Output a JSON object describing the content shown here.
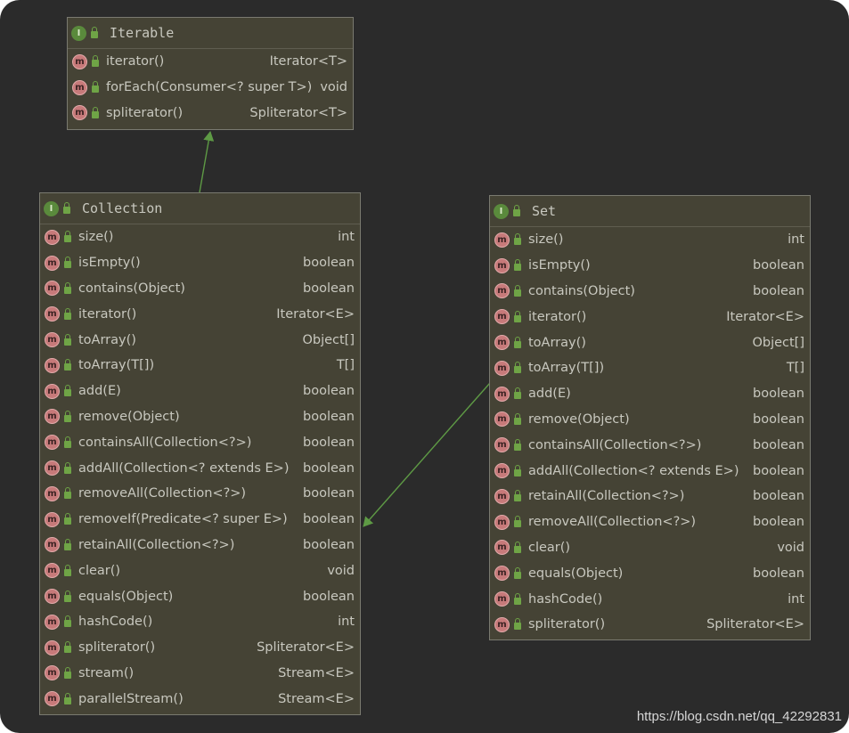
{
  "diagram": {
    "classes": [
      {
        "id": "iterable",
        "name": "Iterable",
        "kind_icon": "I",
        "methods": [
          {
            "name": "iterator()",
            "type": "Iterator<T>"
          },
          {
            "name": "forEach(Consumer<? super T>)",
            "type": "void"
          },
          {
            "name": "spliterator()",
            "type": "Spliterator<T>"
          }
        ]
      },
      {
        "id": "collection",
        "name": "Collection",
        "kind_icon": "I",
        "methods": [
          {
            "name": "size()",
            "type": "int"
          },
          {
            "name": "isEmpty()",
            "type": "boolean"
          },
          {
            "name": "contains(Object)",
            "type": "boolean"
          },
          {
            "name": "iterator()",
            "type": "Iterator<E>"
          },
          {
            "name": "toArray()",
            "type": "Object[]"
          },
          {
            "name": "toArray(T[])",
            "type": "T[]"
          },
          {
            "name": "add(E)",
            "type": "boolean"
          },
          {
            "name": "remove(Object)",
            "type": "boolean"
          },
          {
            "name": "containsAll(Collection<?>)",
            "type": "boolean"
          },
          {
            "name": "addAll(Collection<? extends E>)",
            "type": "boolean"
          },
          {
            "name": "removeAll(Collection<?>)",
            "type": "boolean"
          },
          {
            "name": "removeIf(Predicate<? super E>)",
            "type": "boolean"
          },
          {
            "name": "retainAll(Collection<?>)",
            "type": "boolean"
          },
          {
            "name": "clear()",
            "type": "void"
          },
          {
            "name": "equals(Object)",
            "type": "boolean"
          },
          {
            "name": "hashCode()",
            "type": "int"
          },
          {
            "name": "spliterator()",
            "type": "Spliterator<E>"
          },
          {
            "name": "stream()",
            "type": "Stream<E>"
          },
          {
            "name": "parallelStream()",
            "type": "Stream<E>"
          }
        ]
      },
      {
        "id": "set",
        "name": "Set",
        "kind_icon": "I",
        "methods": [
          {
            "name": "size()",
            "type": "int"
          },
          {
            "name": "isEmpty()",
            "type": "boolean"
          },
          {
            "name": "contains(Object)",
            "type": "boolean"
          },
          {
            "name": "iterator()",
            "type": "Iterator<E>"
          },
          {
            "name": "toArray()",
            "type": "Object[]"
          },
          {
            "name": "toArray(T[])",
            "type": "T[]"
          },
          {
            "name": "add(E)",
            "type": "boolean"
          },
          {
            "name": "remove(Object)",
            "type": "boolean"
          },
          {
            "name": "containsAll(Collection<?>)",
            "type": "boolean"
          },
          {
            "name": "addAll(Collection<? extends E>)",
            "type": "boolean"
          },
          {
            "name": "retainAll(Collection<?>)",
            "type": "boolean"
          },
          {
            "name": "removeAll(Collection<?>)",
            "type": "boolean"
          },
          {
            "name": "clear()",
            "type": "void"
          },
          {
            "name": "equals(Object)",
            "type": "boolean"
          },
          {
            "name": "hashCode()",
            "type": "int"
          },
          {
            "name": "spliterator()",
            "type": "Spliterator<E>"
          }
        ]
      }
    ],
    "method_icon": "m",
    "edges": [
      {
        "from": "collection",
        "to": "iterable",
        "kind": "extends"
      },
      {
        "from": "set",
        "to": "collection",
        "kind": "extends"
      }
    ]
  },
  "colors": {
    "background": "#2b2b2b",
    "box_fill": "#454335",
    "edge": "#5e9a45"
  },
  "watermark": "https://blog.csdn.net/qq_42292831"
}
